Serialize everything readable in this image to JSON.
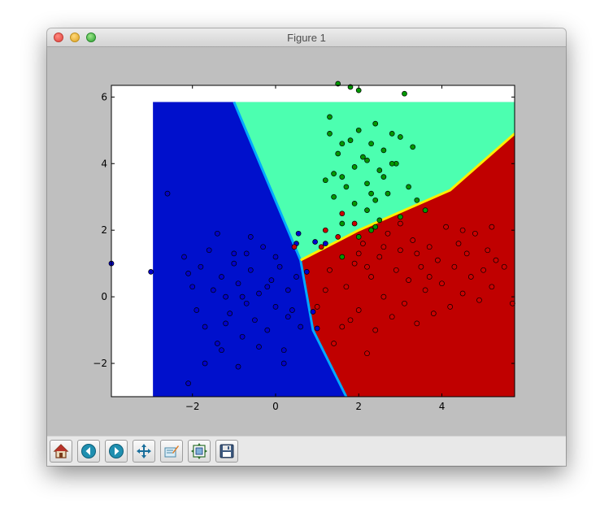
{
  "window": {
    "title": "Figure 1"
  },
  "toolbar": {
    "buttons": [
      {
        "name": "home-button",
        "icon": "home-icon"
      },
      {
        "name": "back-button",
        "icon": "back-arrow-icon"
      },
      {
        "name": "forward-button",
        "icon": "forward-arrow-icon"
      },
      {
        "name": "pan-button",
        "icon": "pan-arrows-icon"
      },
      {
        "name": "zoom-button",
        "icon": "zoom-rect-icon"
      },
      {
        "name": "subplots-button",
        "icon": "subplots-icon"
      },
      {
        "name": "save-button",
        "icon": "floppy-disk-icon"
      }
    ]
  },
  "chart_data": {
    "type": "scatter",
    "title": "",
    "xlabel": "",
    "ylabel": "",
    "xlim": [
      -3.95,
      5.75
    ],
    "ylim": [
      -3.0,
      6.35
    ],
    "xticks": [
      -2,
      0,
      2,
      4
    ],
    "yticks": [
      -2,
      0,
      2,
      4,
      6
    ],
    "grid": false,
    "background": {
      "type": "decision-regions",
      "x_range": [
        -2.95,
        5.75
      ],
      "y_range": [
        -3.0,
        5.85
      ],
      "regions": [
        {
          "class": 0,
          "color": "#0010cc"
        },
        {
          "class": 1,
          "color": "#4cffb0"
        },
        {
          "class": 2,
          "color": "#c00000"
        }
      ],
      "boundary_colors": [
        "#00aaff",
        "#ffee00"
      ],
      "boundaries": {
        "blue_green": [
          [
            -1.0,
            5.85
          ],
          [
            0.6,
            1.1
          ]
        ],
        "green_red": [
          [
            0.6,
            1.1
          ],
          [
            2.0,
            2.0
          ],
          [
            4.2,
            3.2
          ],
          [
            5.75,
            4.9
          ]
        ],
        "blue_red": [
          [
            0.6,
            1.1
          ],
          [
            0.9,
            -1.0
          ],
          [
            1.7,
            -3.0
          ]
        ]
      }
    },
    "series": [
      {
        "color": "#0000cc",
        "points": [
          [
            -2.6,
            3.1
          ],
          [
            -2.2,
            1.2
          ],
          [
            -2.1,
            0.7
          ],
          [
            -2.0,
            0.3
          ],
          [
            -1.9,
            -0.4
          ],
          [
            -1.8,
            0.9
          ],
          [
            -1.7,
            -0.9
          ],
          [
            -1.6,
            1.4
          ],
          [
            -1.5,
            0.2
          ],
          [
            -1.4,
            -1.4
          ],
          [
            -1.3,
            0.6
          ],
          [
            -1.2,
            0.0
          ],
          [
            -1.1,
            -0.5
          ],
          [
            -1.0,
            1.0
          ],
          [
            -0.9,
            0.4
          ],
          [
            -0.8,
            -1.2
          ],
          [
            -0.7,
            -0.2
          ],
          [
            -0.6,
            0.8
          ],
          [
            -0.5,
            -0.7
          ],
          [
            -0.4,
            0.1
          ],
          [
            -0.3,
            1.5
          ],
          [
            -0.2,
            -1.0
          ],
          [
            -0.1,
            0.5
          ],
          [
            0.0,
            -0.3
          ],
          [
            0.1,
            0.9
          ],
          [
            0.2,
            -1.6
          ],
          [
            0.3,
            0.2
          ],
          [
            0.4,
            -0.4
          ],
          [
            0.5,
            0.6
          ],
          [
            -1.7,
            -2.0
          ],
          [
            -1.3,
            -1.6
          ],
          [
            -0.9,
            -2.1
          ],
          [
            -0.6,
            1.8
          ],
          [
            -1.0,
            1.3
          ],
          [
            -2.1,
            -2.6
          ],
          [
            0.6,
            -0.9
          ],
          [
            0.0,
            1.2
          ],
          [
            -0.4,
            -1.5
          ],
          [
            0.2,
            -2.0
          ],
          [
            -1.4,
            1.9
          ],
          [
            -0.8,
            0.0
          ],
          [
            -0.2,
            0.3
          ],
          [
            0.3,
            -0.6
          ],
          [
            0.5,
            1.6
          ],
          [
            -1.2,
            -0.8
          ],
          [
            -0.7,
            1.3
          ],
          [
            -3.0,
            0.75
          ],
          [
            -3.95,
            1.0
          ],
          [
            0.55,
            1.9
          ],
          [
            0.95,
            1.65
          ],
          [
            1.2,
            1.6
          ],
          [
            0.75,
            0.75
          ],
          [
            0.9,
            -0.45
          ],
          [
            1.0,
            -0.95
          ]
        ]
      },
      {
        "color": "#009900",
        "points": [
          [
            1.3,
            5.4
          ],
          [
            1.5,
            4.3
          ],
          [
            1.6,
            3.6
          ],
          [
            1.8,
            4.7
          ],
          [
            1.9,
            3.9
          ],
          [
            2.0,
            5.0
          ],
          [
            2.1,
            4.2
          ],
          [
            2.2,
            3.4
          ],
          [
            2.3,
            4.6
          ],
          [
            2.4,
            5.2
          ],
          [
            2.5,
            3.8
          ],
          [
            2.6,
            4.4
          ],
          [
            2.7,
            3.1
          ],
          [
            2.8,
            4.9
          ],
          [
            2.9,
            4.0
          ],
          [
            3.0,
            4.8
          ],
          [
            3.2,
            3.3
          ],
          [
            3.3,
            4.5
          ],
          [
            3.4,
            2.9
          ],
          [
            1.4,
            3.0
          ],
          [
            1.7,
            3.3
          ],
          [
            1.9,
            2.8
          ],
          [
            2.2,
            2.6
          ],
          [
            2.5,
            2.3
          ],
          [
            2.0,
            6.2
          ],
          [
            1.5,
            6.4
          ],
          [
            1.8,
            6.3
          ],
          [
            3.1,
            6.1
          ],
          [
            1.4,
            3.7
          ],
          [
            1.6,
            4.6
          ],
          [
            1.3,
            4.9
          ],
          [
            2.4,
            2.9
          ],
          [
            2.6,
            3.6
          ],
          [
            2.8,
            4.0
          ],
          [
            2.3,
            3.1
          ],
          [
            1.2,
            3.5
          ],
          [
            3.0,
            2.4
          ],
          [
            2.2,
            4.1
          ],
          [
            1.6,
            2.2
          ],
          [
            2.3,
            2.0
          ],
          [
            2.0,
            1.8
          ],
          [
            3.6,
            2.6
          ],
          [
            1.6,
            1.2
          ],
          [
            2.4,
            2.1
          ]
        ]
      },
      {
        "color": "#cc0000",
        "points": [
          [
            1.1,
            1.5
          ],
          [
            1.3,
            0.8
          ],
          [
            1.5,
            1.8
          ],
          [
            1.7,
            0.3
          ],
          [
            1.9,
            1.0
          ],
          [
            2.0,
            -0.4
          ],
          [
            2.1,
            1.6
          ],
          [
            2.3,
            0.6
          ],
          [
            2.4,
            -1.0
          ],
          [
            2.5,
            1.2
          ],
          [
            2.6,
            0.0
          ],
          [
            2.7,
            1.9
          ],
          [
            2.8,
            -0.6
          ],
          [
            2.9,
            0.8
          ],
          [
            3.0,
            1.4
          ],
          [
            3.1,
            -0.2
          ],
          [
            3.2,
            0.5
          ],
          [
            3.3,
            1.7
          ],
          [
            3.4,
            -0.8
          ],
          [
            3.5,
            0.9
          ],
          [
            3.6,
            0.2
          ],
          [
            3.7,
            1.5
          ],
          [
            3.8,
            -0.5
          ],
          [
            3.9,
            1.1
          ],
          [
            4.0,
            0.4
          ],
          [
            4.1,
            2.1
          ],
          [
            4.2,
            -0.3
          ],
          [
            4.3,
            0.9
          ],
          [
            4.4,
            1.6
          ],
          [
            4.5,
            0.1
          ],
          [
            4.6,
            1.3
          ],
          [
            4.7,
            0.6
          ],
          [
            4.8,
            1.9
          ],
          [
            4.9,
            -0.1
          ],
          [
            5.0,
            0.8
          ],
          [
            5.1,
            1.4
          ],
          [
            5.2,
            0.3
          ],
          [
            5.3,
            1.1
          ],
          [
            5.5,
            0.9
          ],
          [
            5.7,
            -0.2
          ],
          [
            1.2,
            0.2
          ],
          [
            1.8,
            -0.7
          ],
          [
            2.2,
            0.9
          ],
          [
            3.0,
            2.2
          ],
          [
            3.4,
            1.3
          ],
          [
            2.0,
            1.3
          ],
          [
            2.6,
            1.5
          ],
          [
            3.7,
            0.6
          ],
          [
            4.5,
            2.0
          ],
          [
            5.2,
            2.1
          ],
          [
            1.6,
            2.5
          ],
          [
            1.9,
            2.2
          ],
          [
            1.2,
            2.0
          ],
          [
            0.45,
            1.5
          ],
          [
            1.0,
            -0.3
          ],
          [
            1.4,
            -1.4
          ],
          [
            1.6,
            -0.9
          ],
          [
            2.2,
            -1.7
          ]
        ]
      }
    ]
  }
}
